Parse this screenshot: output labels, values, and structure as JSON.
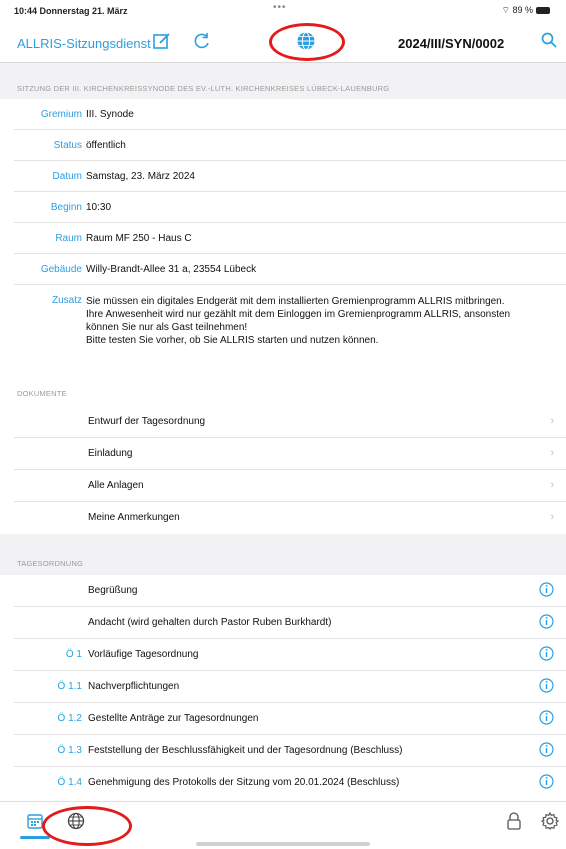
{
  "status_bar": {
    "time": "10:44  Donnerstag 21. März",
    "dots": "•••",
    "battery": "⌔ 89 %"
  },
  "navbar": {
    "app_title": "ALLRIS-Sitzungsdienst",
    "meeting_id": "2024/III/SYN/0002",
    "icons": [
      "edit-icon",
      "refresh-icon",
      "globe-icon",
      "search-icon"
    ],
    "accent_color": "#2a9fe0",
    "highlight_color": "#e21b1b"
  },
  "meeting": {
    "header": "SITZUNG DER III. KIRCHENKREISSYNODE DES EV.-LUTH. KIRCHENKREISES LÜBECK-LAUENBURG",
    "fields": [
      {
        "label": "Gremium",
        "value": "III. Synode"
      },
      {
        "label": "Status",
        "value": "öffentlich"
      },
      {
        "label": "Datum",
        "value": "Samstag, 23. März 2024"
      },
      {
        "label": "Beginn",
        "value": "10:30"
      },
      {
        "label": "Raum",
        "value": "Raum MF 250 - Haus C"
      },
      {
        "label": "Gebäude",
        "value": "Willy-Brandt-Allee 31 a, 23554 Lübeck"
      }
    ],
    "zusatz_label": "Zusatz",
    "zusatz_lines": [
      "Sie müssen ein digitales Endgerät mit dem installierten Gremienprogramm ALLRIS mitbringen.",
      "Ihre Anwesenheit wird nur gezählt mit dem Einloggen im Gremienprogramm ALLRIS, ansonsten",
      "können Sie nur als Gast teilnehmen!",
      "Bitte testen Sie vorher, ob Sie ALLRIS starten und nutzen können."
    ]
  },
  "documents": {
    "header": "DOKUMENTE",
    "items": [
      "Entwurf der Tagesordnung",
      "Einladung",
      "Alle Anlagen",
      "Meine Anmerkungen"
    ]
  },
  "agenda": {
    "header": "TAGESORDNUNG",
    "items": [
      {
        "num": "",
        "title": "Begrüßung"
      },
      {
        "num": "",
        "title": "Andacht (wird gehalten durch Pastor Ruben Burkhardt)"
      },
      {
        "num": "Ö 1",
        "title": "Vorläufige Tagesordnung"
      },
      {
        "num": "Ö 1.1",
        "title": "Nachverpflichtungen"
      },
      {
        "num": "Ö 1.2",
        "title": "Gestellte Anträge zur Tagesordnungen"
      },
      {
        "num": "Ö 1.3",
        "title": "Feststellung der Beschlussfähigkeit und der Tagesordnung (Beschluss)"
      },
      {
        "num": "Ö 1.4",
        "title": "Genehmigung des Protokolls der Sitzung vom 20.01.2024 (Beschluss)"
      }
    ]
  },
  "tabbar": {
    "icons": [
      "calendar-icon",
      "globe-icon",
      "lock-icon",
      "gear-icon"
    ]
  }
}
